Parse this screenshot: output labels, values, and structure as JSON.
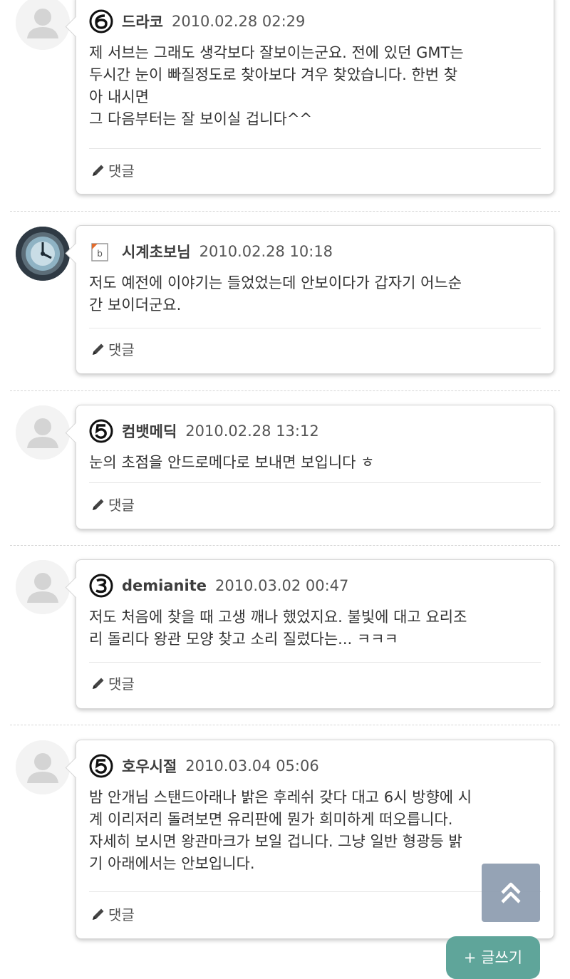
{
  "reply_label": "댓글",
  "write_label": "+ 글쓰기",
  "colors": {
    "accent": "#5fa59a",
    "top_button": "#8c9baf",
    "border": "#d6d6d6"
  },
  "comments": [
    {
      "nickname": "드라코",
      "date": "2010.02.28 02:29",
      "level_icon": "level-6-icon",
      "avatar": "default-avatar",
      "text": "제 서브는 그래도 생각보다 잘보이는군요. 전에 있던 GMT는\n두시간 눈이 빠질정도로 찾아보다 겨우 찾았습니다. 한번 찾\n아 내시면\n그 다음부터는 잘 보이실 겁니다^^"
    },
    {
      "nickname": "시계초보님",
      "date": "2010.02.28 10:18",
      "level_icon": "blog-level-icon",
      "avatar": "watch-photo-avatar",
      "text": "저도 예전에 이야기는 들었었는데 안보이다가 갑자기 어느순\n간 보이더군요."
    },
    {
      "nickname": "컴뱃메딕",
      "date": "2010.02.28 13:12",
      "level_icon": "level-5-icon",
      "avatar": "default-avatar",
      "text": "눈의 초점을 안드로메다로 보내면 보입니다 ㅎ"
    },
    {
      "nickname": "demianite",
      "date": "2010.03.02 00:47",
      "level_icon": "level-3-icon",
      "avatar": "default-avatar",
      "text": "저도 처음에 찾을 때 고생 깨나 했었지요. 불빛에 대고 요리조\n리 돌리다 왕관 모양 찾고 소리 질렀다는... ㅋㅋㅋ"
    },
    {
      "nickname": "호우시절",
      "date": "2010.03.04 05:06",
      "level_icon": "level-5-icon",
      "avatar": "default-avatar",
      "text": "밤 안개님 스탠드아래나 밝은 후레쉬 갖다 대고 6시 방향에 시\n계 이리저리 돌려보면 유리판에 뭔가 희미하게 떠오릅니다.\n자세히 보시면 왕관마크가 보일 겁니다. 그냥 일반 형광등 밝\n기 아래에서는 안보입니다."
    }
  ]
}
